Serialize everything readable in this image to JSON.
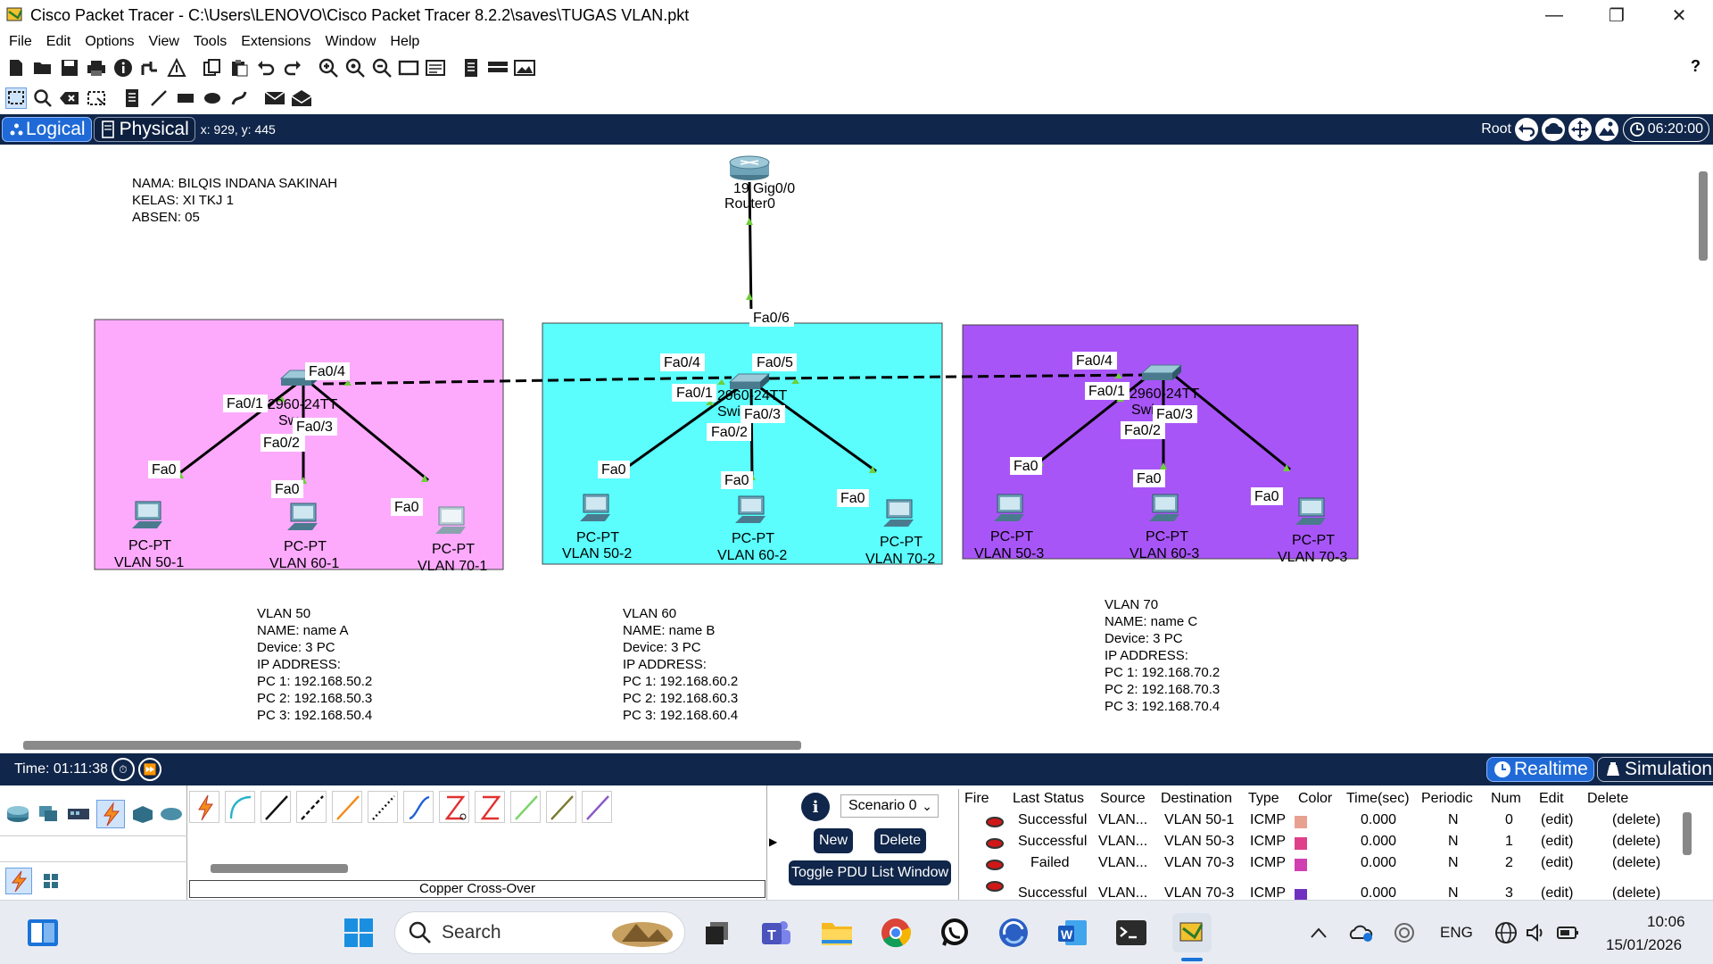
{
  "window": {
    "title": "Cisco Packet Tracer - C:\\Users\\LENOVO\\Cisco Packet Tracer 8.2.2\\saves\\TUGAS VLAN.pkt"
  },
  "menu": [
    "File",
    "Edit",
    "Options",
    "View",
    "Tools",
    "Extensions",
    "Window",
    "Help"
  ],
  "help_glyph": "?",
  "workspace_bar": {
    "logical_tab": "Logical",
    "physical_tab": "Physical",
    "coordinates": "x: 929, y: 445",
    "root_label": "Root",
    "clock": "06:20:00"
  },
  "colors": {
    "vlan50_area": "#fdaafd",
    "vlan60_area": "#5bfdfd",
    "vlan70_area": "#a855f7",
    "dark_bar": "#10264a",
    "accent_blue": "#1f6ad6"
  },
  "note_student": {
    "line1": "NAMA: BILQIS INDANA SAKINAH",
    "line2": "KELAS: XI TKJ 1",
    "line3": "ABSEN: 05"
  },
  "router": {
    "label_left": "19",
    "port_label": "Gig0/0",
    "name": "Router0",
    "uplink_port": "Fa0/6"
  },
  "vlans": [
    {
      "switch_model": "2960-24TT",
      "switch_name": "Sw",
      "ports": {
        "p1": "Fa0/1",
        "p2": "Fa0/2",
        "p3": "Fa0/3",
        "p4": "Fa0/4"
      },
      "pcs": [
        {
          "type": "PC-PT",
          "name": "VLAN 50-1",
          "port": "Fa0"
        },
        {
          "type": "PC-PT",
          "name": "VLAN 60-1",
          "port": "Fa0"
        },
        {
          "type": "PC-PT",
          "name": "VLAN 70-1",
          "port": "Fa0"
        }
      ],
      "note": {
        "l1": "VLAN 50",
        "l2": "NAME: name A",
        "l3": "Device: 3 PC",
        "l4": "IP ADDRESS:",
        "l5": "PC 1: 192.168.50.2",
        "l6": "PC 2: 192.168.50.3",
        "l7": "PC 3: 192.168.50.4"
      }
    },
    {
      "switch_model": "2960-24TT",
      "switch_name": "Swi",
      "ports": {
        "p1": "Fa0/1",
        "p2": "Fa0/2",
        "p3": "Fa0/3",
        "p4": "Fa0/4",
        "p5": "Fa0/5"
      },
      "pcs": [
        {
          "type": "PC-PT",
          "name": "VLAN 50-2",
          "port": "Fa0"
        },
        {
          "type": "PC-PT",
          "name": "VLAN 60-2",
          "port": "Fa0"
        },
        {
          "type": "PC-PT",
          "name": "VLAN 70-2",
          "port": "Fa0"
        }
      ],
      "note": {
        "l1": "VLAN 60",
        "l2": "NAME: name B",
        "l3": "Device: 3 PC",
        "l4": "IP ADDRESS:",
        "l5": "PC 1: 192.168.60.2",
        "l6": "PC 2: 192.168.60.3",
        "l7": "PC 3: 192.168.60.4"
      }
    },
    {
      "switch_model": "2960-24TT",
      "switch_name": "Swi",
      "ports": {
        "p1": "Fa0/1",
        "p2": "Fa0/2",
        "p3": "Fa0/3",
        "p4": "Fa0/4"
      },
      "pcs": [
        {
          "type": "PC-PT",
          "name": "VLAN 50-3",
          "port": "Fa0"
        },
        {
          "type": "PC-PT",
          "name": "VLAN 60-3",
          "port": "Fa0"
        },
        {
          "type": "PC-PT",
          "name": "VLAN 70-3",
          "port": "Fa0"
        }
      ],
      "note": {
        "l1": "VLAN 70",
        "l2": "NAME: name C",
        "l3": "Device: 3 PC",
        "l4": "IP ADDRESS:",
        "l5": "PC 1: 192.168.70.2",
        "l6": "PC 2: 192.168.70.3",
        "l7": "PC 3: 192.168.70.4"
      }
    }
  ],
  "sim_bar": {
    "time": "Time: 01:11:38",
    "realtime": "Realtime",
    "simulation": "Simulation"
  },
  "connections_panel": {
    "selected_label": "Copper Cross-Over"
  },
  "scenario": {
    "selected": "Scenario 0",
    "new_button": "New",
    "delete_button": "Delete",
    "toggle_button": "Toggle PDU List Window"
  },
  "pdu_list": {
    "headers": [
      "Fire",
      "Last Status",
      "Source",
      "Destination",
      "Type",
      "Color",
      "Time(sec)",
      "Periodic",
      "Num",
      "Edit",
      "Delete"
    ],
    "rows": [
      {
        "status": "Successful",
        "source": "VLAN...",
        "destination": "VLAN 50-1",
        "type": "ICMP",
        "color": "#e8a090",
        "time": "0.000",
        "periodic": "N",
        "num": "0",
        "edit": "(edit)",
        "delete": "(delete)"
      },
      {
        "status": "Successful",
        "source": "VLAN...",
        "destination": "VLAN 50-3",
        "type": "ICMP",
        "color": "#e0408a",
        "time": "0.000",
        "periodic": "N",
        "num": "1",
        "edit": "(edit)",
        "delete": "(delete)"
      },
      {
        "status": "Failed",
        "source": "VLAN...",
        "destination": "VLAN 70-3",
        "type": "ICMP",
        "color": "#d040b0",
        "time": "0.000",
        "periodic": "N",
        "num": "2",
        "edit": "(edit)",
        "delete": "(delete)"
      },
      {
        "status": "Successful",
        "source": "VLAN...",
        "destination": "VLAN 70-3",
        "type": "ICMP",
        "color": "#7030c0",
        "time": "0.000",
        "periodic": "N",
        "num": "3",
        "edit": "(edit)",
        "delete": "(delete)"
      }
    ]
  },
  "taskbar": {
    "search_placeholder": "Search",
    "lang": "ENG",
    "time": "10:06",
    "date": "15/01/2026"
  }
}
